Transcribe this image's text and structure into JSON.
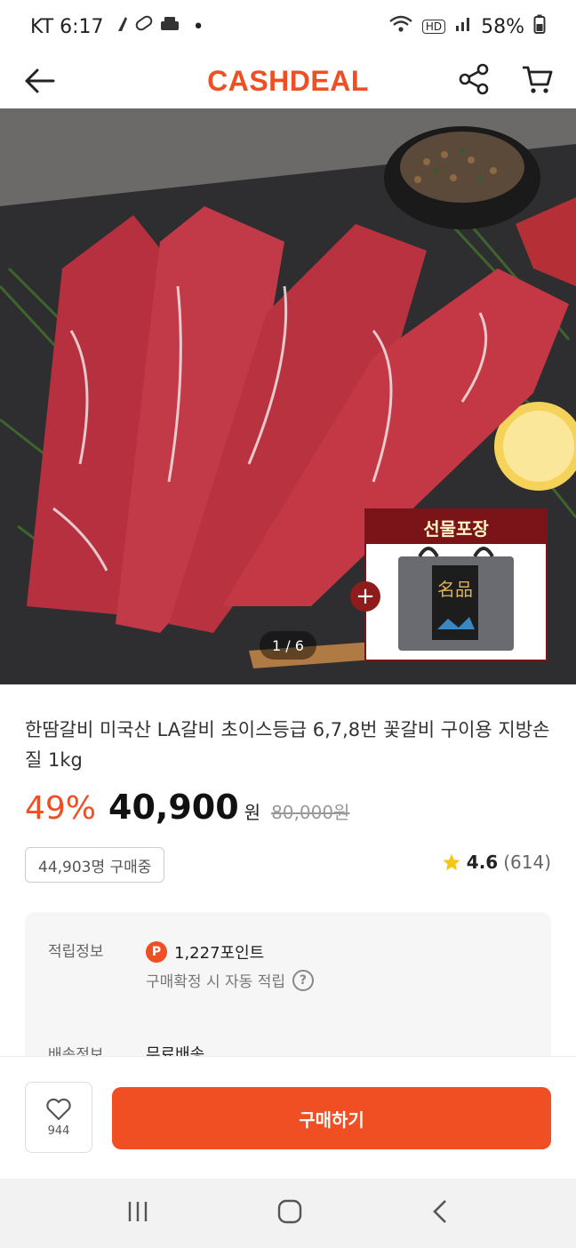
{
  "status_bar": {
    "carrier_time": "KT 6:17",
    "dot": "•",
    "hd_label": "HD",
    "battery": "58%"
  },
  "header": {
    "logo": "CASHDEAL",
    "back_icon": "arrow-left-icon",
    "share_icon": "share-icon",
    "cart_icon": "cart-icon"
  },
  "hero": {
    "pager": "1 / 6",
    "gift_title": "선물포장",
    "gift_box_label": "名品",
    "plus": "+"
  },
  "product": {
    "title": "한땀갈비 미국산 LA갈비 초이스등급 6,7,8번 꽃갈비 구이용 지방손질 1kg",
    "discount": "49%",
    "price": "40,900",
    "currency": "원",
    "original_price": "80,000원",
    "buyers": "44,903명 구매중",
    "rating": "4.6",
    "rating_count": "(614)"
  },
  "info": {
    "points_label": "적립정보",
    "points_badge": "P",
    "points_value": "1,227포인트",
    "points_note": "구매확정 시 자동 적립",
    "help": "?",
    "shipping_label": "배송정보",
    "shipping_value": "무료배송"
  },
  "bottom": {
    "like_count": "944",
    "buy_label": "구매하기"
  },
  "colors": {
    "brand": "#f04e23",
    "gift": "#7a1418"
  }
}
